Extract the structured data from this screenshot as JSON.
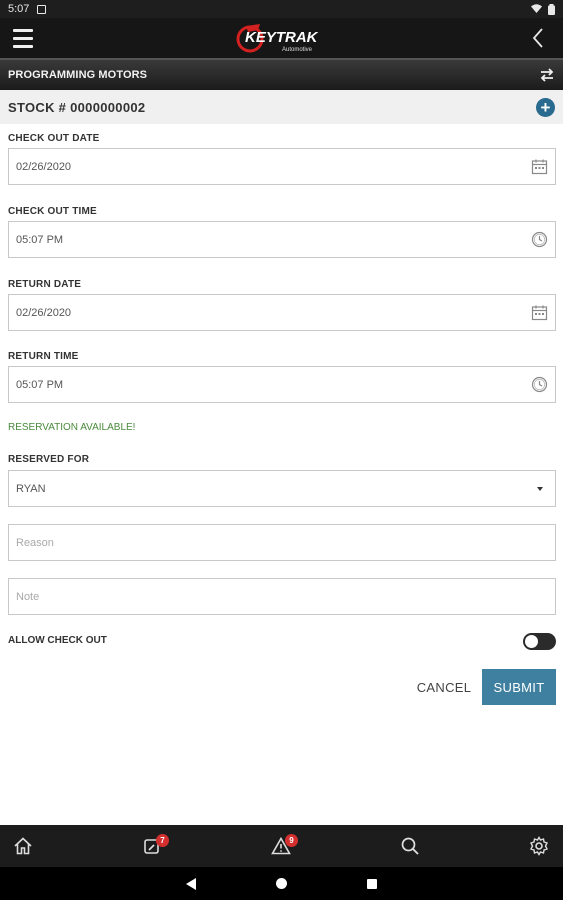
{
  "status_bar": {
    "time": "5:07"
  },
  "app_bar": {
    "logo_text": "KEYTRAK",
    "logo_subtext": "Automotive"
  },
  "section": {
    "title": "PROGRAMMING MOTORS"
  },
  "stock": {
    "label": "STOCK # 0000000002"
  },
  "form": {
    "checkout_date": {
      "label": "CHECK OUT DATE",
      "value": "02/26/2020"
    },
    "checkout_time": {
      "label": "CHECK OUT TIME",
      "value": "05:07 PM"
    },
    "return_date": {
      "label": "RETURN DATE",
      "value": "02/26/2020"
    },
    "return_time": {
      "label": "RETURN TIME",
      "value": "05:07 PM"
    },
    "availability_message": "RESERVATION AVAILABLE!",
    "reserved_for": {
      "label": "RESERVED FOR",
      "value": "RYAN"
    },
    "reason": {
      "placeholder": "Reason",
      "value": ""
    },
    "note": {
      "placeholder": "Note",
      "value": ""
    },
    "allow_checkout": {
      "label": "ALLOW CHECK OUT",
      "checked": false
    }
  },
  "actions": {
    "cancel_label": "CANCEL",
    "submit_label": "SUBMIT"
  },
  "bottom_nav": {
    "items": [
      {
        "icon": "home-icon"
      },
      {
        "icon": "keys-icon",
        "badge": "7"
      },
      {
        "icon": "alert-icon",
        "badge": "9"
      },
      {
        "icon": "search-icon"
      },
      {
        "icon": "gear-icon"
      }
    ]
  },
  "colors": {
    "accent": "#3f7fa0",
    "success": "#4a8a3c",
    "badge": "#d32f2f",
    "header": "#161616"
  }
}
